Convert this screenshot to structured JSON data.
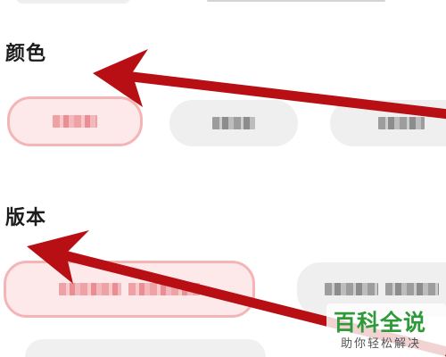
{
  "sections": {
    "color": {
      "title": "颜色"
    },
    "version": {
      "title": "版本"
    }
  },
  "watermark": {
    "main": "百科全说",
    "sub": "助你轻松解决"
  },
  "colors": {
    "selected_bg": "#fde9ea",
    "selected_border": "#f4b5b7",
    "chip_bg": "#efefef",
    "arrow": "#b80f14",
    "watermark_green": "#2f9a3a"
  },
  "icons": {
    "arrow_color": "red-arrow-icon",
    "arrow_version": "red-arrow-icon"
  }
}
